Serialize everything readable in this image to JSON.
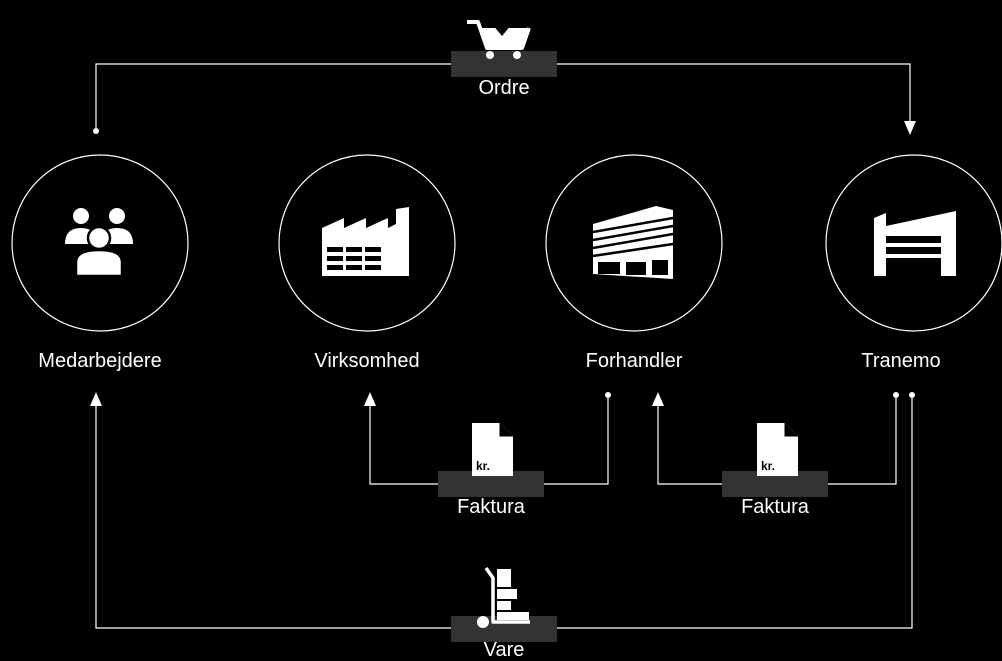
{
  "nodes": {
    "medarbejdere": "Medarbejdere",
    "virksomhed": "Virksomhed",
    "forhandler": "Forhandler",
    "tranemo": "Tranemo"
  },
  "flows": {
    "order": "Ordre",
    "invoice_left": "Faktura",
    "invoice_right": "Faktura",
    "goods": "Vare"
  },
  "invoice_icon_text": "kr.",
  "colors": {
    "background": "#000000",
    "foreground": "#ffffff",
    "label_box": "#333333"
  },
  "icons": [
    "cart-icon",
    "people-icon",
    "factory-icon",
    "building-icon",
    "warehouse-icon",
    "invoice-icon",
    "hand-truck-icon"
  ]
}
